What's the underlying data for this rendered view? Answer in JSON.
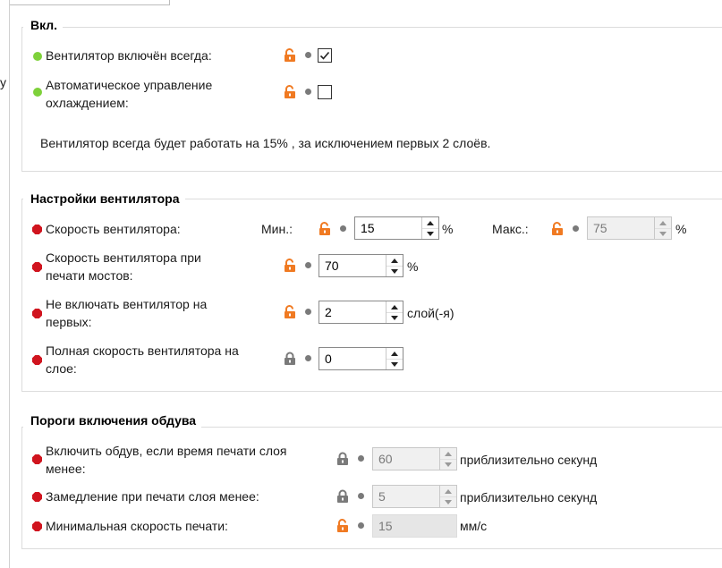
{
  "colors": {
    "accent_lock_open": "#f07a22",
    "lock_closed": "#7a7a7a",
    "dot_green": "#7ed13a",
    "dot_red": "#d0141e"
  },
  "left_panel": {
    "fragment": "у"
  },
  "enable": {
    "title": "Вкл.",
    "fan_always_label": "Вентилятор включён всегда:",
    "fan_always_checked": true,
    "auto_cooling_label": "Автоматическое управление\nохлаждением:",
    "auto_cooling_checked": false,
    "info_text": "Вентилятор всегда будет работать на 15% , за исключением первых 2 слоёв."
  },
  "fan_settings": {
    "title": "Настройки вентилятора",
    "speed_label": "Скорость вентилятора:",
    "min_label": "Мин.:",
    "min_value": "15",
    "min_unit": "%",
    "max_label": "Макс.:",
    "max_value": "75",
    "max_unit": "%",
    "bridges_label": "Скорость вентилятора при\nпечати мостов:",
    "bridges_value": "70",
    "bridges_unit": "%",
    "disable_first_label": "Не включать вентилятор на\nпервых:",
    "disable_first_value": "2",
    "disable_first_unit": "слой(-я)",
    "full_speed_label": "Полная скорость вентилятора на\nслое:",
    "full_speed_value": "0"
  },
  "thresholds": {
    "title": "Пороги включения обдува",
    "enable_below_label": "Включить обдув, если время печати слоя\nменее:",
    "enable_below_value": "60",
    "enable_below_unit": "приблизительно секунд",
    "slowdown_label": "Замедление при печати слоя менее:",
    "slowdown_value": "5",
    "slowdown_unit": "приблизительно секунд",
    "min_speed_label": "Минимальная скорость печати:",
    "min_speed_value": "15",
    "min_speed_unit": "мм/с"
  }
}
